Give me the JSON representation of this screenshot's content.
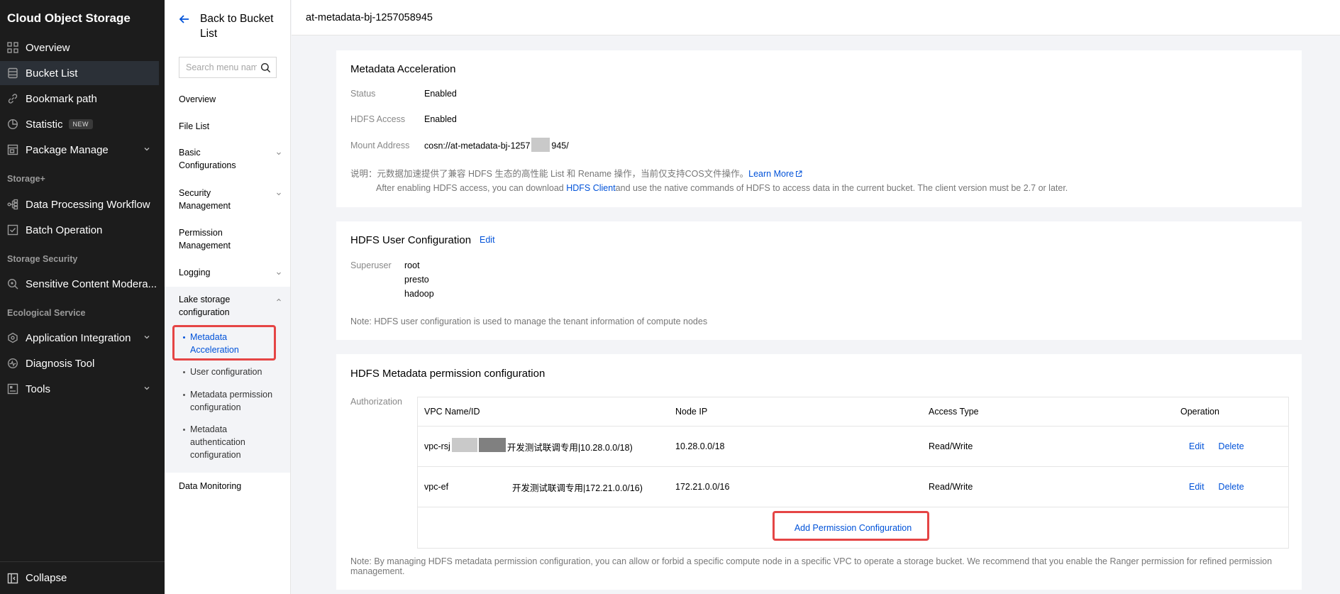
{
  "nav": {
    "title": "Cloud Object Storage",
    "items": [
      {
        "label": "Overview",
        "icon": "grid-icon"
      },
      {
        "label": "Bucket List",
        "icon": "database-icon"
      },
      {
        "label": "Bookmark path",
        "icon": "link-icon"
      },
      {
        "label": "Statistic",
        "icon": "pie-chart-icon",
        "badge": "NEW"
      },
      {
        "label": "Package Manage",
        "icon": "package-icon"
      }
    ],
    "groups": [
      "Storage+",
      "Storage Security",
      "Ecological Service"
    ],
    "storage_items": [
      {
        "label": "Data Processing Workflow",
        "icon": "workflow-icon"
      },
      {
        "label": "Batch Operation",
        "icon": "batch-icon"
      }
    ],
    "security_items": [
      {
        "label": "Sensitive Content Modera...",
        "icon": "scan-icon"
      }
    ],
    "eco_items": [
      {
        "label": "Application Integration",
        "icon": "integration-icon"
      },
      {
        "label": "Diagnosis Tool",
        "icon": "diagnosis-icon"
      },
      {
        "label": "Tools",
        "icon": "tools-icon"
      }
    ],
    "collapse": "Collapse"
  },
  "subnav": {
    "back": "Back to Bucket List",
    "search_placeholder": "Search menu name",
    "items": [
      "Overview",
      "File List",
      "Basic Configurations",
      "Security Management",
      "Permission Management",
      "Logging",
      "Lake storage configuration",
      "Data Monitoring"
    ],
    "children": [
      "Metadata Acceleration",
      "User configuration",
      "Metadata permission configuration",
      "Metadata authentication configuration"
    ]
  },
  "header": {
    "bucket": "at-metadata-bj-1257058945"
  },
  "metadata": {
    "title": "Metadata Acceleration",
    "status_label": "Status",
    "status_value": "Enabled",
    "hdfs_label": "HDFS Access",
    "hdfs_value": "Enabled",
    "mount_label": "Mount Address",
    "mount_prefix": "cosn://at-metadata-bj-1257",
    "mount_suffix": "945/",
    "note_prefix": "说明：元数据加速提供了兼容 HDFS 生态的高性能 List 和 Rename 操作，当前仅支持COS文件操作。",
    "learn_more": "Learn More",
    "note_line2_prefix": "After enabling HDFS access, you can download ",
    "hdfs_client": "HDFS Client",
    "note_line2_suffix": "and use the native commands of HDFS to access data in the current bucket. The client version must be 2.7 or later."
  },
  "user_config": {
    "title": "HDFS User Configuration",
    "edit": "Edit",
    "superuser_label": "Superuser",
    "users": [
      "root",
      "presto",
      "hadoop"
    ],
    "note": "Note: HDFS user configuration is used to manage the tenant information of compute nodes"
  },
  "permission": {
    "title": "HDFS Metadata permission configuration",
    "auth_label": "Authorization",
    "columns": [
      "VPC Name/ID",
      "Node IP",
      "Access Type",
      "Operation"
    ],
    "rows": [
      {
        "vpc_prefix": "vpc-rsj",
        "vpc_suffix": "开发测试联调专用|10.28.0.0/18)",
        "ip": "10.28.0.0/18",
        "access": "Read/Write"
      },
      {
        "vpc_prefix": "vpc-ef",
        "vpc_suffix": "开发测试联调专用|172.21.0.0/16)",
        "ip": "172.21.0.0/16",
        "access": "Read/Write"
      }
    ],
    "edit": "Edit",
    "delete": "Delete",
    "add": "Add Permission Configuration",
    "note": "Note: By managing HDFS metadata permission configuration, you can allow or forbid a specific compute node in a specific VPC to operate a storage bucket. We recommend that you enable the Ranger permission for refined permission management."
  }
}
